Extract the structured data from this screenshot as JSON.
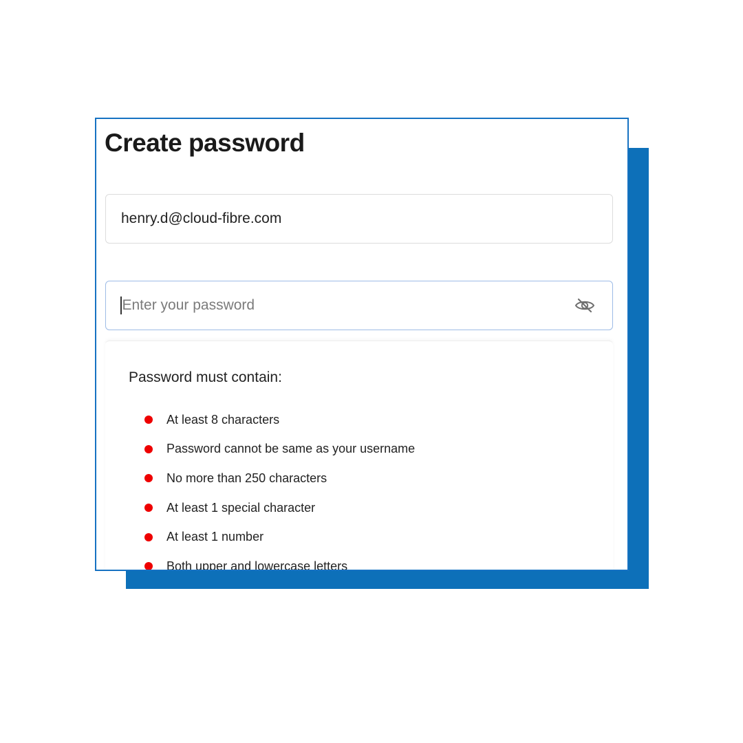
{
  "page": {
    "title": "Create password"
  },
  "email_field": {
    "value": "henry.d@cloud-fibre.com"
  },
  "password_field": {
    "value": "",
    "placeholder": "Enter your password",
    "visibility_icon": "eye-slash-icon"
  },
  "requirements": {
    "heading": "Password must contain:",
    "status_color": "#ee0000",
    "items": [
      {
        "label": "At least 8 characters",
        "met": false
      },
      {
        "label": "Password cannot be same as your username",
        "met": false
      },
      {
        "label": "No more than 250 characters",
        "met": false
      },
      {
        "label": "At least 1 special character",
        "met": false
      },
      {
        "label": "At least 1 number",
        "met": false
      },
      {
        "label": "Both upper and lowercase letters",
        "met": false
      }
    ]
  },
  "colors": {
    "accent": "#0d70b9",
    "card_border": "#1672c2",
    "focus_border": "#9dbbe6"
  }
}
